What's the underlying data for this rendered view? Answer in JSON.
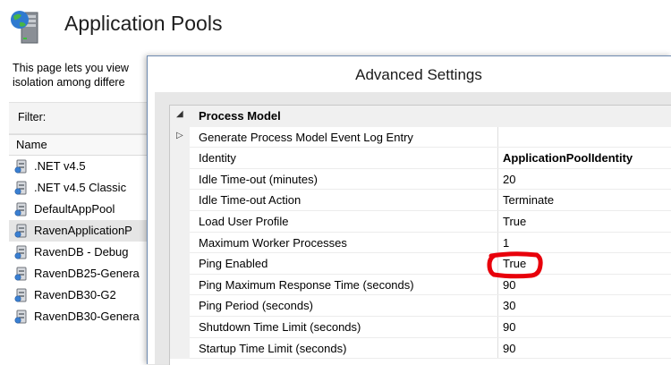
{
  "page": {
    "title": "Application Pools",
    "description_line1": "This page lets you view",
    "description_line2": "isolation among differe",
    "filter_label": "Filter:",
    "column_name": "Name",
    "pools": [
      {
        "name": ".NET v4.5",
        "selected": false
      },
      {
        "name": ".NET v4.5 Classic",
        "selected": false
      },
      {
        "name": "DefaultAppPool",
        "selected": false
      },
      {
        "name": "RavenApplicationP",
        "selected": true
      },
      {
        "name": "RavenDB - Debug",
        "selected": false
      },
      {
        "name": "RavenDB25-Genera",
        "selected": false
      },
      {
        "name": "RavenDB30-G2",
        "selected": false
      },
      {
        "name": "RavenDB30-Genera",
        "selected": false
      }
    ]
  },
  "dialog": {
    "title": "Advanced Settings",
    "category": "Process Model",
    "properties": [
      {
        "name": "Generate Process Model Event Log Entry",
        "value": "",
        "expandable": true
      },
      {
        "name": "Identity",
        "value": "ApplicationPoolIdentity",
        "bold": true
      },
      {
        "name": "Idle Time-out (minutes)",
        "value": "20"
      },
      {
        "name": "Idle Time-out Action",
        "value": "Terminate"
      },
      {
        "name": "Load User Profile",
        "value": "True"
      },
      {
        "name": "Maximum Worker Processes",
        "value": "1"
      },
      {
        "name": "Ping Enabled",
        "value": "True",
        "highlighted": true
      },
      {
        "name": "Ping Maximum Response Time (seconds)",
        "value": "90"
      },
      {
        "name": "Ping Period (seconds)",
        "value": "30"
      },
      {
        "name": "Shutdown Time Limit (seconds)",
        "value": "90"
      },
      {
        "name": "Startup Time Limit (seconds)",
        "value": "90"
      }
    ]
  },
  "colors": {
    "highlight_mark": "#e8000b",
    "selected_row": "#e5e5e5",
    "dialog_border": "#6e8ab0"
  },
  "icons": {
    "page_icon": "server-globe-icon",
    "pool_icon": "app-pool-icon",
    "collapse": "expanded-triangle-icon",
    "expand": "collapsed-triangle-icon"
  }
}
